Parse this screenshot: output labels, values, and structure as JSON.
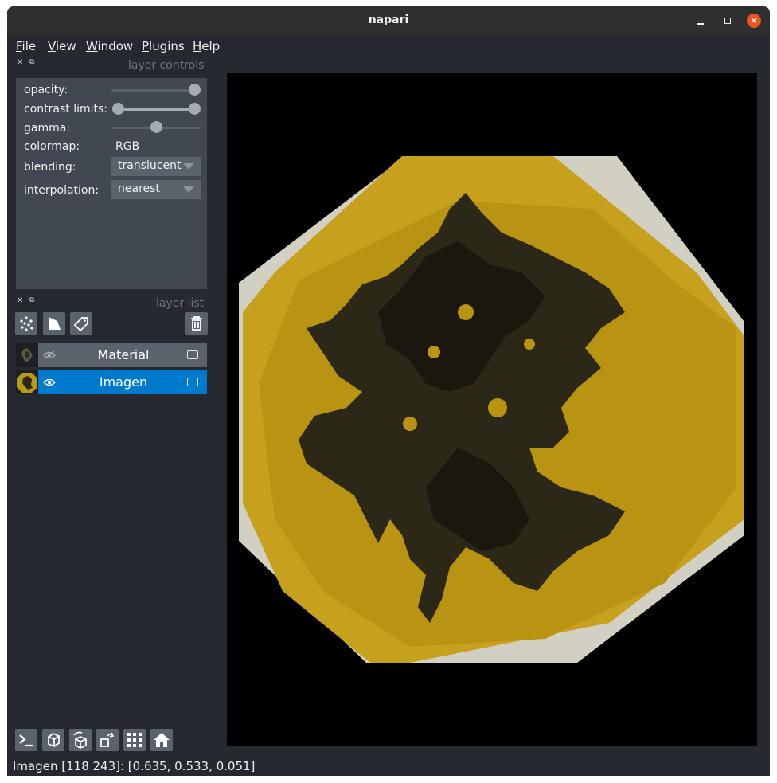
{
  "window": {
    "title": "napari"
  },
  "menubar": [
    {
      "label": "File",
      "mnemonic": "F",
      "rest": "ile"
    },
    {
      "label": "View",
      "mnemonic": "V",
      "rest": "iew"
    },
    {
      "label": "Window",
      "mnemonic": "W",
      "rest": "indow"
    },
    {
      "label": "Plugins",
      "mnemonic": "P",
      "rest": "lugins"
    },
    {
      "label": "Help",
      "mnemonic": "H",
      "rest": "elp"
    }
  ],
  "layer_controls": {
    "header": "layer controls",
    "opacity_label": "opacity:",
    "opacity_value": 1.0,
    "contrast_label": "contrast limits:",
    "contrast_range": [
      0,
      1
    ],
    "gamma_label": "gamma:",
    "gamma_value": 0.5,
    "colormap_label": "colormap:",
    "colormap_value": "RGB",
    "blending_label": "blending:",
    "blending_value": "translucent",
    "interpolation_label": "interpolation:",
    "interpolation_value": "nearest"
  },
  "layer_list": {
    "header": "layer list",
    "layers": [
      {
        "name": "Material",
        "visible": false,
        "selected": false,
        "type": "image-icon"
      },
      {
        "name": "Imagen",
        "visible": true,
        "selected": true,
        "type": "image-icon"
      }
    ]
  },
  "status": {
    "text": "Imagen [118 243]: [0.635, 0.533, 0.051]"
  },
  "colors": {
    "accent": "#007acc",
    "panel": "#414851",
    "background": "#262930",
    "close": "#e95420"
  }
}
